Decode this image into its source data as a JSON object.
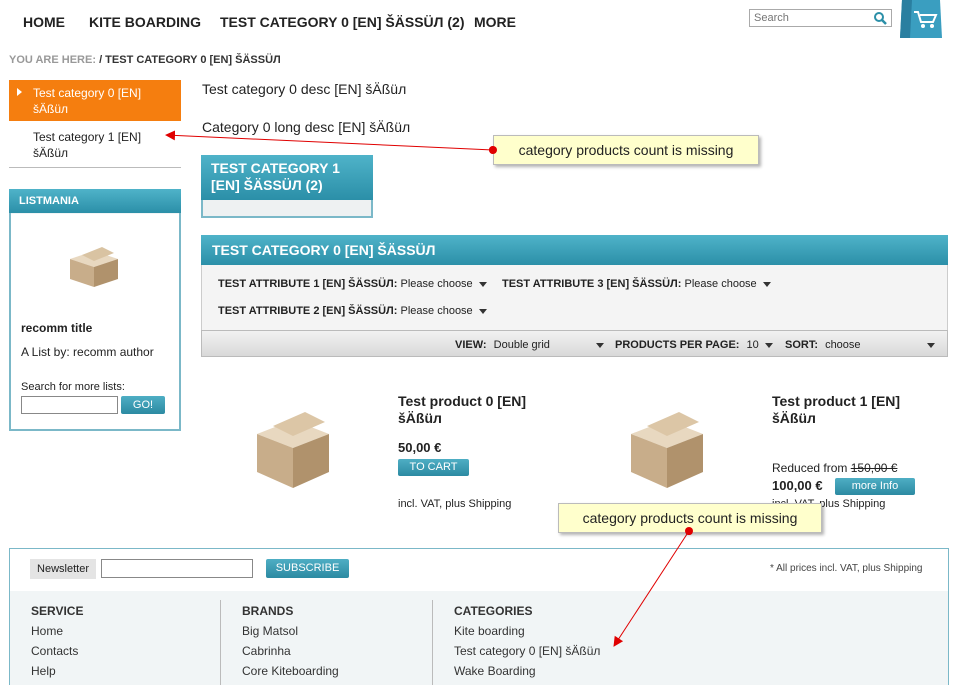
{
  "nav": {
    "items": [
      {
        "label": "HOME"
      },
      {
        "label": "KITE BOARDING"
      },
      {
        "label": "TEST CATEGORY 0 [EN] ŠÄßÜЛ (2)"
      },
      {
        "label": "MORE"
      }
    ],
    "search_placeholder": "Search"
  },
  "icons": {
    "search": "search-icon",
    "basket": "shopping-bag-icon",
    "product": "product-box-icon"
  },
  "breadcrumb": {
    "prefix": "YOU ARE HERE:",
    "current": "/ TEST CATEGORY 0 [EN] ŠÄSSÜЛ"
  },
  "sidebar": {
    "categories": [
      {
        "label": "Test category 0 [EN] šÄßüл",
        "active": true
      },
      {
        "label": "Test category 1 [EN] šÄßüл",
        "active": false
      }
    ],
    "listmania": {
      "title": "LISTMANIA",
      "list_title": "recomm title",
      "author": "A List by: recomm author",
      "search_label": "Search for more lists:",
      "go_label": "GO!"
    }
  },
  "main": {
    "desc": "Test category 0 desc [EN] šÄßüл",
    "long_desc": "Category 0 long desc [EN] šÄßüл",
    "subcategory": "TEST CATEGORY 1 [EN] ŠÄSSÜЛ (2)",
    "listing_title": "TEST CATEGORY 0 [EN] ŠÄSSÜЛ",
    "attributes": [
      {
        "label": "TEST ATTRIBUTE 1 [EN] ŠÄSSÜЛ:",
        "value": "Please choose"
      },
      {
        "label": "TEST ATTRIBUTE 3 [EN] ŠÄSSÜЛ:",
        "value": "Please choose"
      },
      {
        "label": "TEST ATTRIBUTE 2 [EN] ŠÄSSÜЛ:",
        "value": "Please choose"
      }
    ],
    "view": {
      "label": "VIEW:",
      "value": "Double grid"
    },
    "per_page": {
      "label": "PRODUCTS PER PAGE:",
      "value": "10"
    },
    "sort": {
      "label": "SORT:",
      "value": "choose"
    },
    "products": [
      {
        "title": "Test product 0 [EN] šÄßüл",
        "price": "50,00 €",
        "button": "TO CART",
        "vat": "incl. VAT, plus Shipping"
      },
      {
        "title": "Test product 1 [EN] šÄßüл",
        "reduced_prefix": "Reduced from",
        "old_price": "150,00 €",
        "price": "100,00 €",
        "button": "more Info",
        "vat": "incl. VAT, plus Shipping"
      }
    ]
  },
  "footer": {
    "newsletter_label": "Newsletter",
    "subscribe": "SUBSCRIBE",
    "all_prices": "* All prices incl. VAT, plus Shipping",
    "columns": [
      {
        "title": "SERVICE",
        "links": [
          "Home",
          "Contacts",
          "Help"
        ]
      },
      {
        "title": "BRANDS",
        "links": [
          "Big Matsol",
          "Cabrinha",
          "Core Kiteboarding"
        ]
      },
      {
        "title": "CATEGORIES",
        "links": [
          "Kite boarding",
          "Test category 0 [EN] šÄßüл",
          "Wake Boarding"
        ]
      }
    ]
  },
  "annotations": {
    "callout_1": "category products count is missing",
    "callout_2": "category products count is missing",
    "color": "#e00000"
  },
  "colors": {
    "accent_orange": "#f57e0f",
    "accent_teal": "#2b8fa8"
  }
}
